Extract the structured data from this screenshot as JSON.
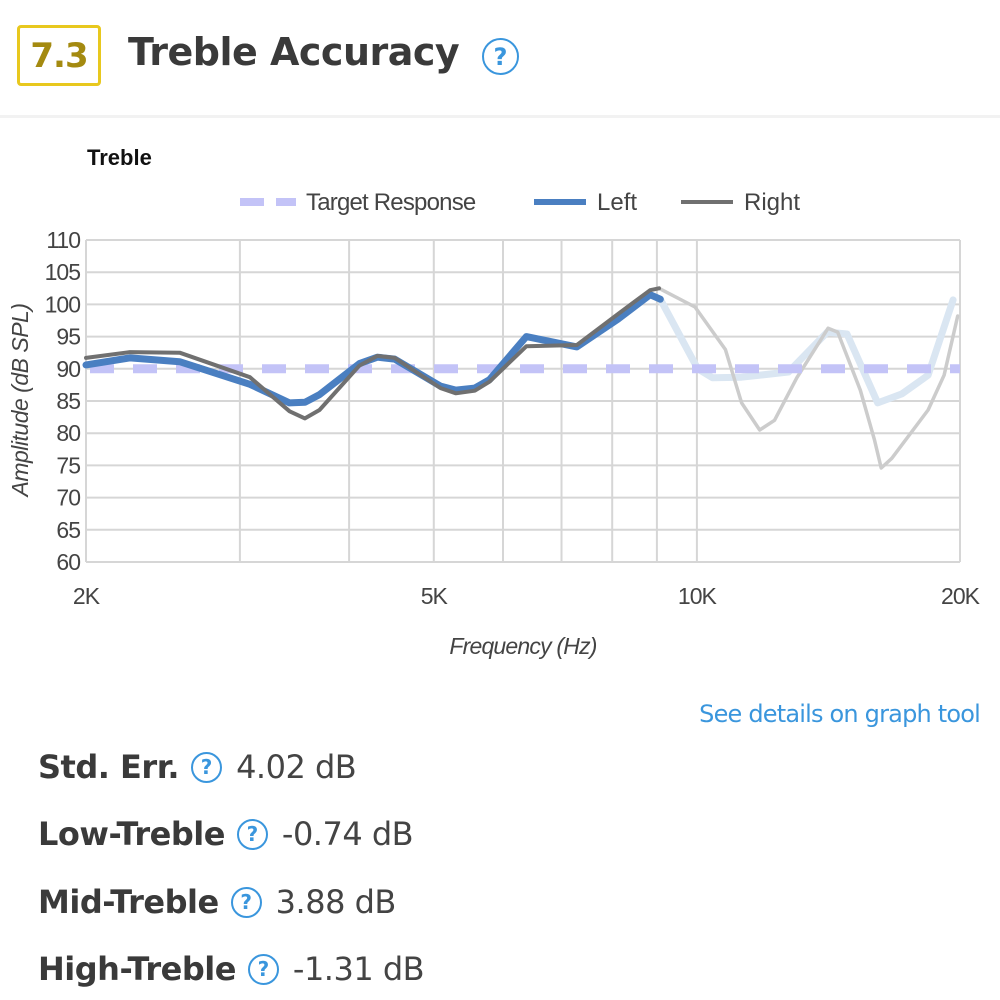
{
  "header": {
    "score": "7.3",
    "title": "Treble Accuracy",
    "help_icon": "question-circle-icon"
  },
  "link": {
    "label": "See details on graph tool"
  },
  "metrics": [
    {
      "label": "Std. Err.",
      "value": "4.02 dB"
    },
    {
      "label": "Low-Treble",
      "value": "-0.74 dB"
    },
    {
      "label": "Mid-Treble",
      "value": "3.88 dB"
    },
    {
      "label": "High-Treble",
      "value": "-1.31 dB"
    }
  ],
  "colors": {
    "score_border": "#e8c81e",
    "score_text": "#a48a10",
    "accent": "#3a96dd",
    "target": "#c3c3f7",
    "left": "#4a7fc1",
    "left_faded": "#dae6f2",
    "right": "#707070",
    "right_faded": "#cccccc",
    "grid": "#d6d6d6"
  },
  "chart_data": {
    "type": "line",
    "title": "Treble",
    "xlabel": "Frequency (Hz)",
    "ylabel": "Amplitude (dB SPL)",
    "xscale": "log",
    "xlim": [
      2000,
      20000
    ],
    "ylim": [
      60,
      110
    ],
    "grid": true,
    "legend": "top-center",
    "x_ticks": [
      {
        "value": 2000,
        "label": "2K"
      },
      {
        "value": 5000,
        "label": "5K"
      },
      {
        "value": 10000,
        "label": "10K"
      },
      {
        "value": 20000,
        "label": "20K"
      }
    ],
    "x_gridlines": [
      2000,
      3000,
      4000,
      5000,
      6000,
      7000,
      8000,
      9000,
      10000,
      20000
    ],
    "y_ticks": [
      110,
      105,
      100,
      95,
      90,
      85,
      80,
      75,
      70,
      65,
      60
    ],
    "highlight_cutoff_hz": 9100,
    "series": [
      {
        "name": "Target Response",
        "style": "dashed",
        "x": [
          2000,
          20000
        ],
        "y": [
          90,
          90
        ]
      },
      {
        "name": "Left",
        "style": "solid",
        "x": [
          2000,
          2245,
          2560,
          3080,
          3420,
          3560,
          3700,
          4110,
          4310,
          4510,
          5090,
          5300,
          5570,
          5790,
          6380,
          7290,
          8120,
          8840,
          9080,
          10020,
          10420,
          11250,
          12730,
          14100,
          14850,
          16100,
          17160,
          18390,
          19640
        ],
        "y": [
          90.6,
          91.7,
          91.1,
          87.6,
          84.7,
          84.8,
          86.0,
          90.8,
          91.8,
          91.5,
          87.3,
          86.7,
          87.0,
          88.3,
          95.0,
          93.4,
          97.7,
          101.5,
          100.8,
          90.0,
          88.6,
          88.7,
          89.5,
          95.7,
          95.4,
          84.7,
          86.1,
          89.0,
          100.7
        ]
      },
      {
        "name": "Right",
        "style": "solid",
        "x": [
          2000,
          2245,
          2560,
          3080,
          3420,
          3560,
          3700,
          4110,
          4310,
          4510,
          5090,
          5300,
          5570,
          5790,
          6380,
          7290,
          8120,
          8840,
          9050,
          9950,
          10780,
          11250,
          11800,
          12270,
          13010,
          14130,
          14490,
          15380,
          15960,
          16250,
          16710,
          18390,
          19180,
          19880
        ],
        "y": [
          91.7,
          92.6,
          92.5,
          88.7,
          83.4,
          82.3,
          83.6,
          90.5,
          92.0,
          91.7,
          87.0,
          86.2,
          86.6,
          88.0,
          93.5,
          93.7,
          98.5,
          102.2,
          102.5,
          99.6,
          93.0,
          84.7,
          80.5,
          82.0,
          88.6,
          96.3,
          95.7,
          86.7,
          79.0,
          74.6,
          76.1,
          83.6,
          89.0,
          98.2
        ]
      }
    ]
  }
}
